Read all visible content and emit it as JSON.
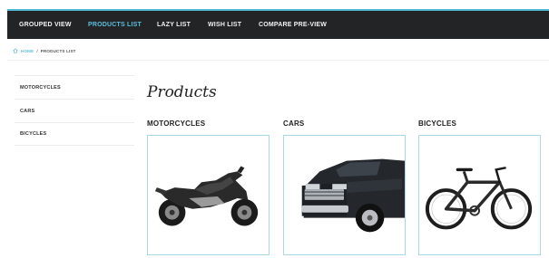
{
  "nav": {
    "items": [
      {
        "label": "GROUPED VIEW",
        "active": false
      },
      {
        "label": "PRODUCTS LIST",
        "active": true
      },
      {
        "label": "LAZY LIST",
        "active": false
      },
      {
        "label": "WISH LIST",
        "active": false
      },
      {
        "label": "COMPARE PRE-VIEW",
        "active": false
      }
    ]
  },
  "breadcrumb": {
    "icon": "home-icon",
    "home": "HOME",
    "separator": "/",
    "current": "PRODUCTS LIST"
  },
  "sidebar": {
    "items": [
      {
        "label": "MOTORCYCLES"
      },
      {
        "label": "CARS"
      },
      {
        "label": "BICYCLES"
      }
    ]
  },
  "main": {
    "title": "Products",
    "categories": [
      {
        "label": "MOTORCYCLES",
        "image": "motorcycle"
      },
      {
        "label": "CARS",
        "image": "pickup-truck"
      },
      {
        "label": "BICYCLES",
        "image": "bicycle"
      }
    ]
  },
  "colors": {
    "topbar": "#222426",
    "accent": "#5bc0de",
    "card_border": "#a9d8e6"
  }
}
